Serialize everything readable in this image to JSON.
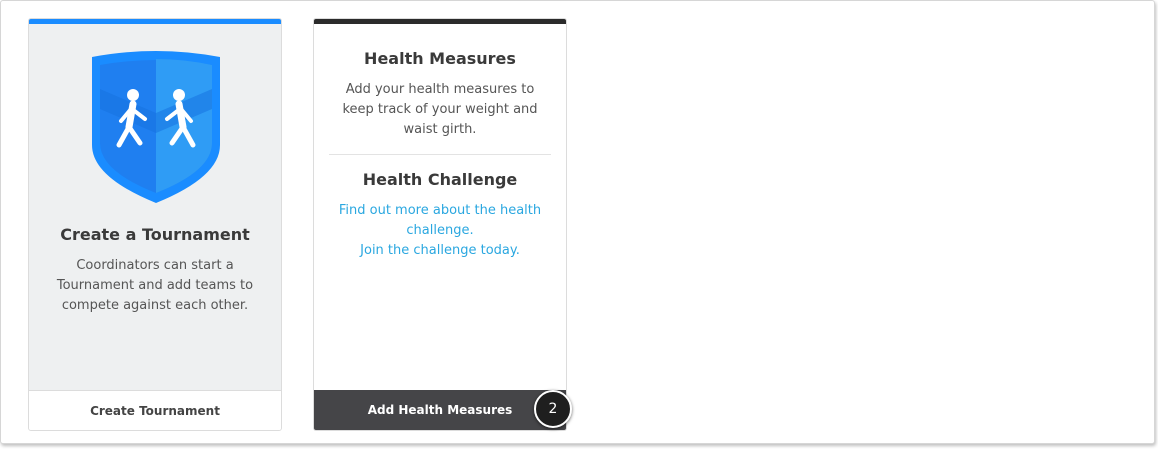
{
  "tournament_card": {
    "title": "Create a Tournament",
    "description": "Coordinators can start a Tournament and add teams to compete against each other.",
    "button_label": "Create Tournament",
    "accent_color": "#1a8cff",
    "icon": "walkers-shield-icon"
  },
  "health_card": {
    "measures": {
      "title": "Health Measures",
      "description": "Add your health measures to keep track of your weight and waist girth."
    },
    "challenge": {
      "title": "Health Challenge",
      "link_line1": "Find out more about the health challenge.",
      "link_line2": "Join the challenge today."
    },
    "button_label": "Add Health Measures",
    "accent_color": "#2b2b2b"
  },
  "step_badge": {
    "number": "2"
  }
}
